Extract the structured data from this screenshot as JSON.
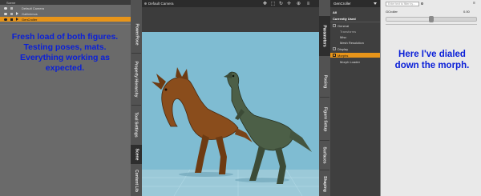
{
  "scene": {
    "header": "Scene",
    "rows": [
      {
        "label": "Default Camera",
        "selected": false
      },
      {
        "label": "Gallimimus",
        "selected": false
      },
      {
        "label": "GenCroller",
        "selected": true
      }
    ]
  },
  "notes": {
    "left": [
      "Fresh load of both figures.",
      "Testing poses, mats.",
      "Everything working as expected."
    ],
    "right": [
      "Here I've dialed",
      "down the morph."
    ]
  },
  "left_tabs": [
    "PowerPose",
    "Property Hierarchy",
    "Tool Settings",
    "Scene",
    "Content Lib"
  ],
  "viewport": {
    "camera": "Default Camera"
  },
  "right_tabs": [
    "Parameters",
    "Posing",
    "Figure Setup",
    "Surfaces",
    "Shaping"
  ],
  "parameters": {
    "title": "GenCroller",
    "rows": [
      {
        "label": "All",
        "kind": "hdr"
      },
      {
        "label": "Currently Used",
        "kind": "hdr"
      },
      {
        "label": "General",
        "kind": "item"
      },
      {
        "label": "Transforms",
        "kind": "sub"
      },
      {
        "label": "Misc",
        "kind": "sub"
      },
      {
        "label": "Mesh Resolution",
        "kind": "sub"
      },
      {
        "label": "Display",
        "kind": "item"
      },
      {
        "label": "Morphs",
        "kind": "sel"
      },
      {
        "label": "Morph Loader",
        "kind": "sub"
      }
    ]
  },
  "properties": {
    "search_placeholder": "Enter text to filter by...",
    "slider": {
      "label": "GCroller",
      "value_text": "0.00",
      "fraction": 0.5
    }
  },
  "colors": {
    "accent": "#e8951a",
    "note": "#0b20d8",
    "viewport_bg": "#7fbcd2"
  },
  "icons": [
    "eye-icon",
    "lock-icon",
    "expand-arrow-icon",
    "search-icon",
    "menu-icon",
    "move-icon",
    "rotate-icon",
    "zoom-icon",
    "frame-icon",
    "camera-icon"
  ]
}
